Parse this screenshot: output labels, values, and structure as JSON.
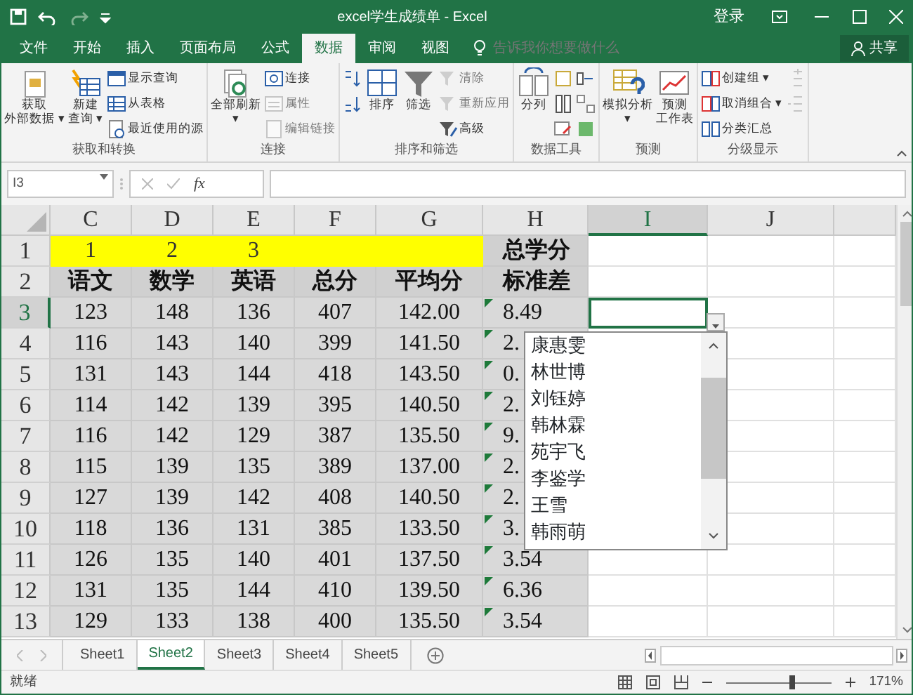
{
  "window": {
    "title": "excel学生成绩单 - Excel",
    "sign_in": "登录"
  },
  "ribbon_tabs": [
    {
      "label": "文件",
      "selected": false
    },
    {
      "label": "开始",
      "selected": false
    },
    {
      "label": "插入",
      "selected": false
    },
    {
      "label": "页面布局",
      "selected": false
    },
    {
      "label": "公式",
      "selected": false
    },
    {
      "label": "数据",
      "selected": true
    },
    {
      "label": "审阅",
      "selected": false
    },
    {
      "label": "视图",
      "selected": false
    }
  ],
  "tell_me": {
    "placeholder": "告诉我你想要做什么"
  },
  "share_button": "共享",
  "ribbon_groups": [
    {
      "label": "获取和转换",
      "buttons": [
        {
          "kind": "large",
          "label": [
            "获取",
            "外部数据 ▾"
          ],
          "disabled": false
        },
        {
          "kind": "large",
          "label": [
            "新建",
            "查询 ▾"
          ],
          "disabled": false
        },
        {
          "kind": "small",
          "label": "显示查询",
          "disabled": false
        },
        {
          "kind": "small",
          "label": "从表格",
          "disabled": false
        },
        {
          "kind": "small",
          "label": "最近使用的源",
          "disabled": false
        }
      ]
    },
    {
      "label": "连接",
      "buttons": [
        {
          "kind": "large",
          "label": [
            "全部刷新",
            "▾"
          ],
          "disabled": false
        },
        {
          "kind": "small",
          "label": "连接",
          "disabled": false
        },
        {
          "kind": "small",
          "label": "属性",
          "disabled": true
        },
        {
          "kind": "small",
          "label": "编辑链接",
          "disabled": true
        }
      ]
    },
    {
      "label": "排序和筛选",
      "buttons": [
        {
          "kind": "icon",
          "disabled": false
        },
        {
          "kind": "icon",
          "disabled": false
        },
        {
          "kind": "large",
          "label": [
            "排序"
          ],
          "disabled": false
        },
        {
          "kind": "large",
          "label": [
            "筛选"
          ],
          "disabled": false
        },
        {
          "kind": "small",
          "label": "清除",
          "disabled": true
        },
        {
          "kind": "small",
          "label": "重新应用",
          "disabled": true
        },
        {
          "kind": "small",
          "label": "高级",
          "disabled": false
        }
      ]
    },
    {
      "label": "数据工具",
      "buttons": [
        {
          "kind": "large",
          "label": [
            "分列"
          ],
          "disabled": false
        },
        {
          "kind": "icon",
          "disabled": false
        },
        {
          "kind": "icon",
          "disabled": false
        },
        {
          "kind": "icon",
          "disabled": false
        },
        {
          "kind": "icon",
          "disabled": false
        },
        {
          "kind": "icon",
          "disabled": false
        },
        {
          "kind": "icon",
          "disabled": false
        }
      ]
    },
    {
      "label": "预测",
      "buttons": [
        {
          "kind": "large",
          "label": [
            "模拟分析",
            "▾"
          ],
          "disabled": false
        },
        {
          "kind": "large",
          "label": [
            "预测",
            "工作表"
          ],
          "disabled": false
        }
      ]
    },
    {
      "label": "分级显示",
      "buttons": [
        {
          "kind": "small",
          "label": "创建组 ▾",
          "disabled": false
        },
        {
          "kind": "small",
          "label": "取消组合 ▾",
          "disabled": false
        },
        {
          "kind": "small",
          "label": "分类汇总",
          "disabled": false
        },
        {
          "kind": "icon",
          "disabled": true
        },
        {
          "kind": "icon",
          "disabled": true
        }
      ]
    }
  ],
  "formula_bar": {
    "name_box": "I3",
    "function_label": "fx"
  },
  "sheet": {
    "columns": [
      {
        "label": "C",
        "selected": false
      },
      {
        "label": "D",
        "selected": false
      },
      {
        "label": "E",
        "selected": false
      },
      {
        "label": "F",
        "selected": false
      },
      {
        "label": "G",
        "selected": false
      },
      {
        "label": "H",
        "selected": false
      },
      {
        "label": "I",
        "selected": true
      },
      {
        "label": "J",
        "selected": false
      }
    ],
    "rows": [
      {
        "number": "1",
        "selected": false,
        "cells": [
          {
            "text": "1",
            "color": "#ffff00"
          },
          {
            "text": "2",
            "color": "#ffff00"
          },
          {
            "text": "3",
            "color": "#ffff00"
          },
          {
            "color": "#ffff00"
          },
          {
            "color": "#ffff00"
          },
          {
            "text": "总学分",
            "color": "#d0d0d0",
            "bold": true
          }
        ]
      },
      {
        "number": "2",
        "selected": false,
        "cells": [
          {
            "text": "语文",
            "color": "#d0d0d0",
            "bold": true
          },
          {
            "text": "数学",
            "color": "#d0d0d0",
            "bold": true
          },
          {
            "text": "英语",
            "color": "#d0d0d0",
            "bold": true
          },
          {
            "text": "总分",
            "color": "#d0d0d0",
            "bold": true
          },
          {
            "text": "平均分",
            "color": "#d0d0d0",
            "bold": true
          },
          {
            "text": "标准差",
            "color": "#d0d0d0",
            "bold": true
          }
        ]
      },
      {
        "number": "3",
        "selected": true,
        "cells": [
          {
            "text": "123",
            "color": "#d9d9d9"
          },
          {
            "text": "148",
            "color": "#d9d9d9"
          },
          {
            "text": "136",
            "color": "#d9d9d9"
          },
          {
            "text": "407",
            "color": "#d9d9d9"
          },
          {
            "text": "142.00",
            "color": "#d9d9d9"
          },
          {
            "text": "8.49",
            "color": "#d9d9d9",
            "flag": true
          }
        ]
      },
      {
        "number": "4",
        "selected": false,
        "cells": [
          {
            "text": "116",
            "color": "#d9d9d9"
          },
          {
            "text": "143",
            "color": "#d9d9d9"
          },
          {
            "text": "140",
            "color": "#d9d9d9"
          },
          {
            "text": "399",
            "color": "#d9d9d9"
          },
          {
            "text": "141.50",
            "color": "#d9d9d9"
          },
          {
            "text": "2.",
            "color": "#d9d9d9",
            "flag": true
          }
        ]
      },
      {
        "number": "5",
        "selected": false,
        "cells": [
          {
            "text": "131",
            "color": "#d9d9d9"
          },
          {
            "text": "143",
            "color": "#d9d9d9"
          },
          {
            "text": "144",
            "color": "#d9d9d9"
          },
          {
            "text": "418",
            "color": "#d9d9d9"
          },
          {
            "text": "143.50",
            "color": "#d9d9d9"
          },
          {
            "text": "0.",
            "color": "#d9d9d9",
            "flag": true
          }
        ]
      },
      {
        "number": "6",
        "selected": false,
        "cells": [
          {
            "text": "114",
            "color": "#d9d9d9"
          },
          {
            "text": "142",
            "color": "#d9d9d9"
          },
          {
            "text": "139",
            "color": "#d9d9d9"
          },
          {
            "text": "395",
            "color": "#d9d9d9"
          },
          {
            "text": "140.50",
            "color": "#d9d9d9"
          },
          {
            "text": "2.",
            "color": "#d9d9d9",
            "flag": true
          }
        ]
      },
      {
        "number": "7",
        "selected": false,
        "cells": [
          {
            "text": "116",
            "color": "#d9d9d9"
          },
          {
            "text": "142",
            "color": "#d9d9d9"
          },
          {
            "text": "129",
            "color": "#d9d9d9"
          },
          {
            "text": "387",
            "color": "#d9d9d9"
          },
          {
            "text": "135.50",
            "color": "#d9d9d9"
          },
          {
            "text": "9.",
            "color": "#d9d9d9",
            "flag": true
          }
        ]
      },
      {
        "number": "8",
        "selected": false,
        "cells": [
          {
            "text": "115",
            "color": "#d9d9d9"
          },
          {
            "text": "139",
            "color": "#d9d9d9"
          },
          {
            "text": "135",
            "color": "#d9d9d9"
          },
          {
            "text": "389",
            "color": "#d9d9d9"
          },
          {
            "text": "137.00",
            "color": "#d9d9d9"
          },
          {
            "text": "2.",
            "color": "#d9d9d9",
            "flag": true
          }
        ]
      },
      {
        "number": "9",
        "selected": false,
        "cells": [
          {
            "text": "127",
            "color": "#d9d9d9"
          },
          {
            "text": "139",
            "color": "#d9d9d9"
          },
          {
            "text": "142",
            "color": "#d9d9d9"
          },
          {
            "text": "408",
            "color": "#d9d9d9"
          },
          {
            "text": "140.50",
            "color": "#d9d9d9"
          },
          {
            "text": "2.",
            "color": "#d9d9d9",
            "flag": true
          }
        ]
      },
      {
        "number": "10",
        "selected": false,
        "cells": [
          {
            "text": "118",
            "color": "#d9d9d9"
          },
          {
            "text": "136",
            "color": "#d9d9d9"
          },
          {
            "text": "131",
            "color": "#d9d9d9"
          },
          {
            "text": "385",
            "color": "#d9d9d9"
          },
          {
            "text": "133.50",
            "color": "#d9d9d9"
          },
          {
            "text": "3.",
            "color": "#d9d9d9",
            "flag": true
          }
        ]
      },
      {
        "number": "11",
        "selected": false,
        "cells": [
          {
            "text": "126",
            "color": "#d9d9d9"
          },
          {
            "text": "135",
            "color": "#d9d9d9"
          },
          {
            "text": "140",
            "color": "#d9d9d9"
          },
          {
            "text": "401",
            "color": "#d9d9d9"
          },
          {
            "text": "137.50",
            "color": "#d9d9d9"
          },
          {
            "text": "3.54",
            "color": "#d9d9d9",
            "flag": true
          }
        ]
      },
      {
        "number": "12",
        "selected": false,
        "cells": [
          {
            "text": "131",
            "color": "#d9d9d9"
          },
          {
            "text": "135",
            "color": "#d9d9d9"
          },
          {
            "text": "144",
            "color": "#d9d9d9"
          },
          {
            "text": "410",
            "color": "#d9d9d9"
          },
          {
            "text": "139.50",
            "color": "#d9d9d9"
          },
          {
            "text": "6.36",
            "color": "#d9d9d9",
            "flag": true
          }
        ]
      },
      {
        "number": "13",
        "selected": false,
        "cells": [
          {
            "text": "129",
            "color": "#d9d9d9"
          },
          {
            "text": "133",
            "color": "#d9d9d9"
          },
          {
            "text": "138",
            "color": "#d9d9d9"
          },
          {
            "text": "400",
            "color": "#d9d9d9"
          },
          {
            "text": "135.50",
            "color": "#d9d9d9"
          },
          {
            "text": "3.54",
            "color": "#d9d9d9",
            "flag": true
          }
        ]
      }
    ]
  },
  "dropdown_list": {
    "items": [
      "康惠雯",
      "林世博",
      "刘钰婷",
      "韩林霖",
      "苑宇飞",
      "李鉴学",
      "王雪",
      "韩雨萌"
    ]
  },
  "sheet_tabs": [
    {
      "label": "Sheet1",
      "selected": false
    },
    {
      "label": "Sheet2",
      "selected": true
    },
    {
      "label": "Sheet3",
      "selected": false
    },
    {
      "label": "Sheet4",
      "selected": false
    },
    {
      "label": "Sheet5",
      "selected": false
    }
  ],
  "status_bar": {
    "status": "就绪",
    "zoom": "171%",
    "zoom_slider": {
      "level": 0.6
    }
  }
}
